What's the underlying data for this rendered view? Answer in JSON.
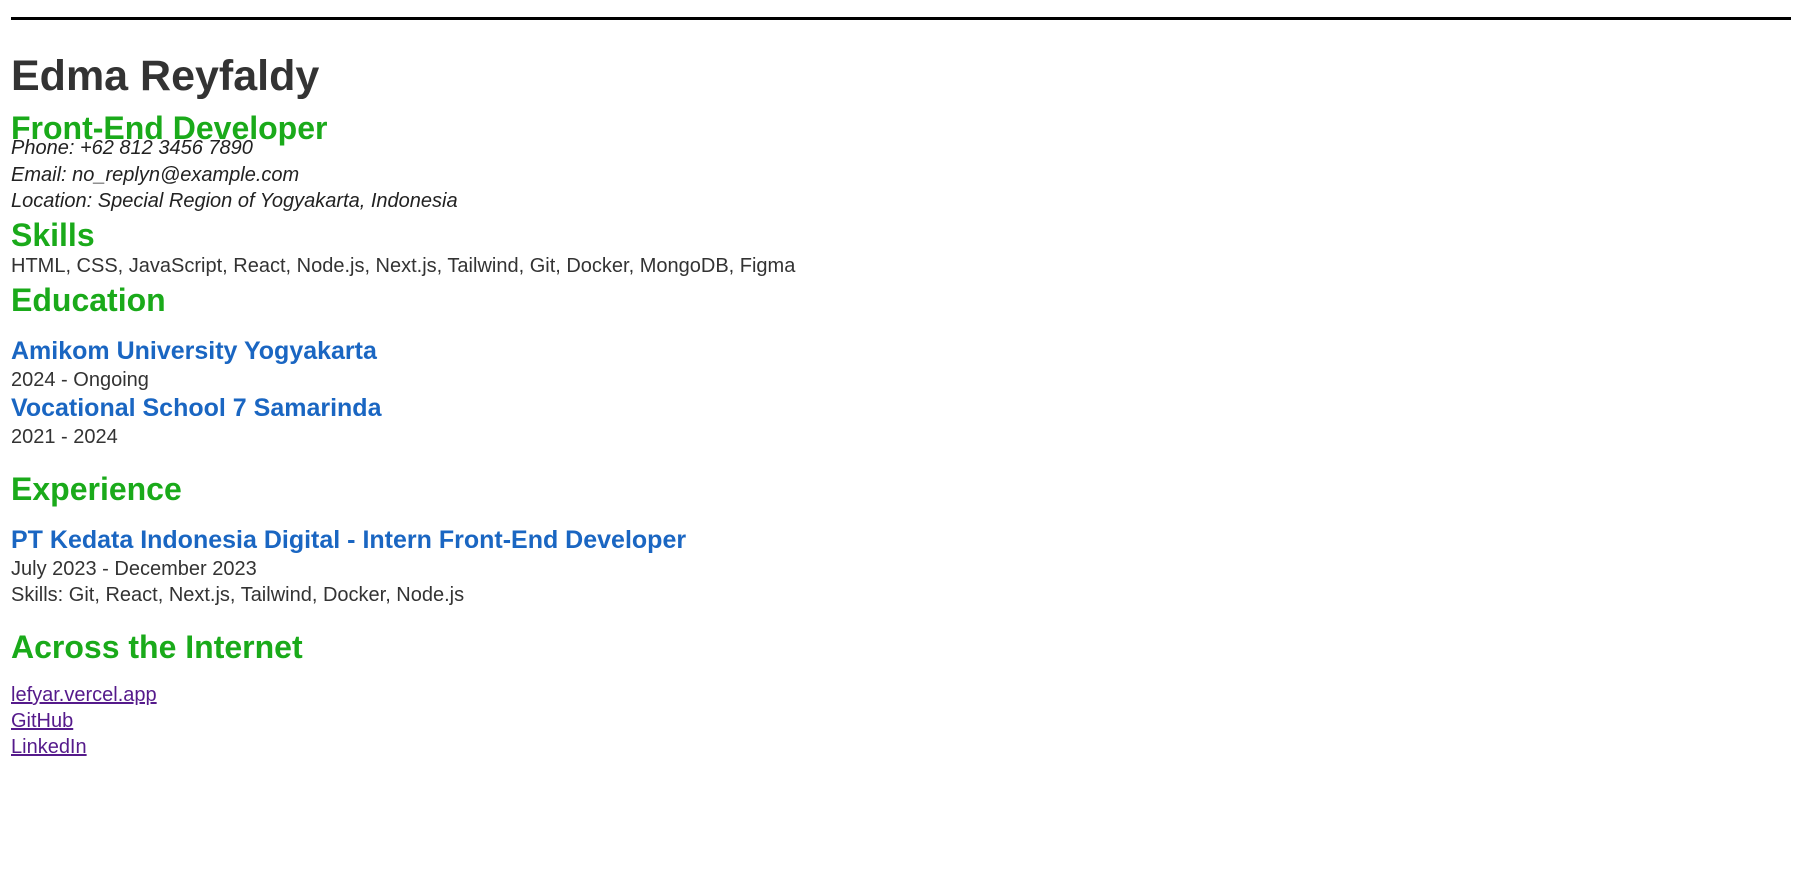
{
  "header": {
    "name": "Edma Reyfaldy",
    "role": "Front-End Developer"
  },
  "contact": {
    "phone": "Phone: +62 812 3456 7890",
    "email": "Email: no_replyn@example.com",
    "location": "Location: Special Region of Yogyakarta, Indonesia"
  },
  "skills": {
    "title": "Skills",
    "list": "HTML, CSS, JavaScript, React, Node.js, Next.js, Tailwind, Git, Docker, MongoDB, Figma"
  },
  "education": {
    "title": "Education",
    "items": [
      {
        "school": "Amikom University Yogyakarta",
        "period": "2024 - Ongoing"
      },
      {
        "school": "Vocational School 7 Samarinda",
        "period": "2021 - 2024"
      }
    ]
  },
  "experience": {
    "title": "Experience",
    "items": [
      {
        "position": "PT Kedata Indonesia Digital - Intern Front-End Developer",
        "period": "July 2023 - December 2023",
        "skills": "Skills: Git, React, Next.js, Tailwind, Docker, Node.js"
      }
    ]
  },
  "internet": {
    "title": "Across the Internet",
    "links": [
      {
        "label": "lefyar.vercel.app"
      },
      {
        "label": "GitHub"
      },
      {
        "label": "LinkedIn"
      }
    ]
  },
  "colors": {
    "section_heading": "#1aaa1a",
    "entry_title": "#1a66c2",
    "visited_link": "#551a8b",
    "body_text": "#333333"
  }
}
